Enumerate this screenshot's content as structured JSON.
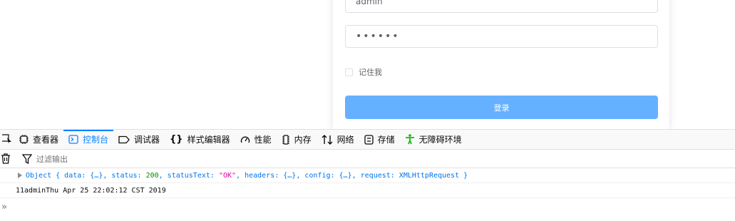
{
  "login": {
    "username_value": "admin",
    "password_value": "••••••",
    "remember_label": "记住我",
    "login_button": "登录"
  },
  "devtools": {
    "tabs": [
      {
        "label": "查看器",
        "icon": "inspector-icon"
      },
      {
        "label": "控制台",
        "icon": "console-icon"
      },
      {
        "label": "调试器",
        "icon": "debugger-icon"
      },
      {
        "label": "样式编辑器",
        "icon": "style-editor-icon"
      },
      {
        "label": "性能",
        "icon": "performance-icon"
      },
      {
        "label": "内存",
        "icon": "memory-icon"
      },
      {
        "label": "网络",
        "icon": "network-icon"
      },
      {
        "label": "存储",
        "icon": "storage-icon"
      },
      {
        "label": "无障碍环境",
        "icon": "accessibility-icon"
      }
    ],
    "active_tab": "控制台",
    "filter_placeholder": "过滤输出",
    "console": {
      "line1": {
        "prefix": "Object { data: {…}, status: ",
        "status": "200",
        "mid": ", statusText: ",
        "status_text": "\"OK\"",
        "suffix": ", headers: {…}, config: {…}, request: XMLHttpRequest }"
      },
      "line2": "11adminThu Apr 25 22:02:12 CST 2019",
      "prompt": "»"
    },
    "colors": {
      "accent": "#0a84ff",
      "object": "#0074e8",
      "number": "#058b00",
      "string": "#dd00a9"
    }
  }
}
